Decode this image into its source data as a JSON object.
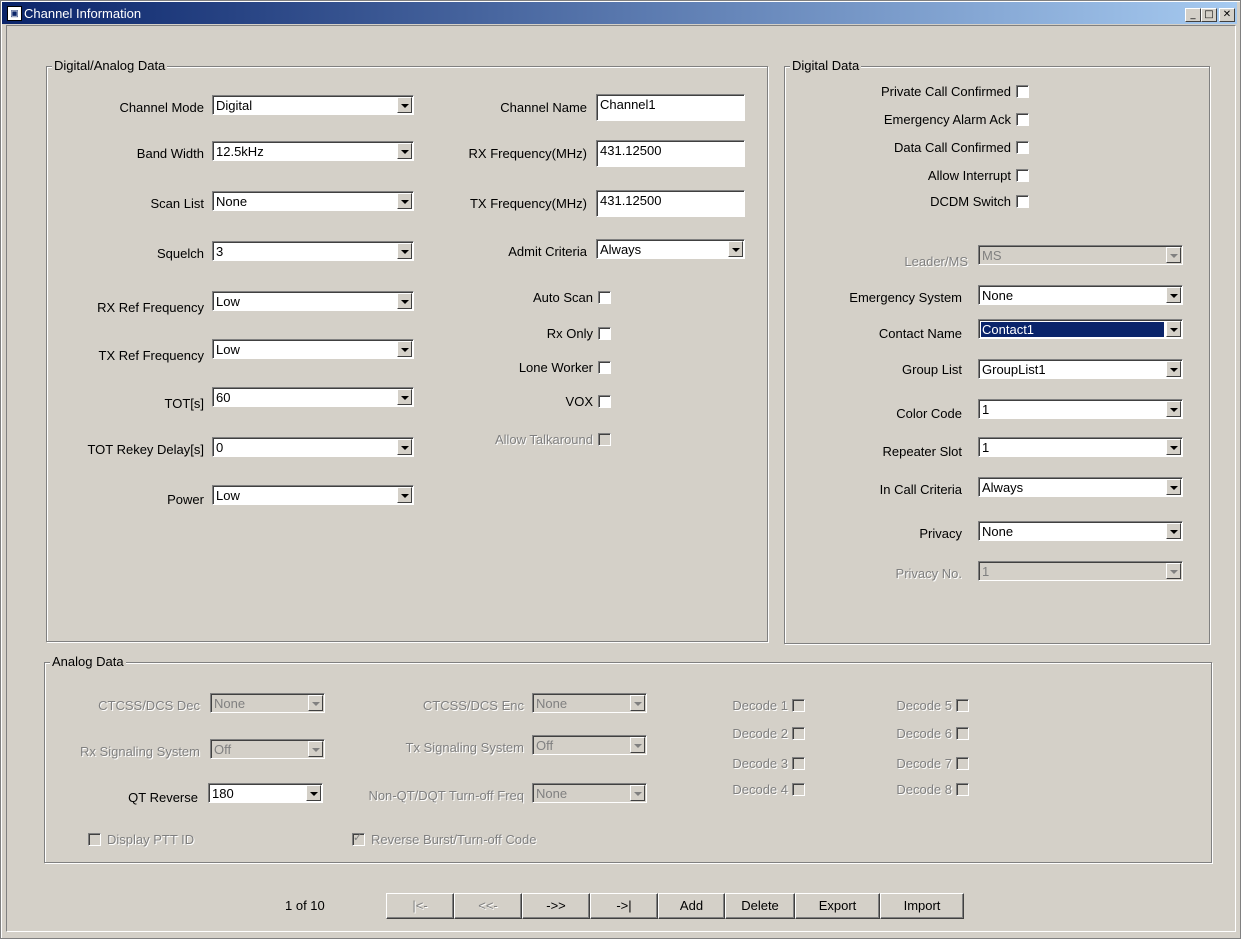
{
  "window": {
    "title": "Channel Information",
    "min_label": "_",
    "max_label": "□",
    "close_label": "✕"
  },
  "digital_analog": {
    "legend": "Digital/Analog Data",
    "channel_mode": {
      "label": "Channel Mode",
      "value": "Digital"
    },
    "band_width": {
      "label": "Band Width",
      "value": "12.5kHz"
    },
    "scan_list": {
      "label": "Scan List",
      "value": "None"
    },
    "squelch": {
      "label": "Squelch",
      "value": "3"
    },
    "rx_ref": {
      "label": "RX Ref Frequency",
      "value": "Low"
    },
    "tx_ref": {
      "label": "TX Ref Frequency",
      "value": "Low"
    },
    "tot": {
      "label": "TOT[s]",
      "value": "60"
    },
    "tot_rekey": {
      "label": "TOT Rekey Delay[s]",
      "value": "0"
    },
    "power": {
      "label": "Power",
      "value": "Low"
    },
    "channel_name": {
      "label": "Channel Name",
      "value": "Channel1"
    },
    "rx_freq": {
      "label": "RX Frequency(MHz)",
      "value": "431.12500"
    },
    "tx_freq": {
      "label": "TX Frequency(MHz)",
      "value": "431.12500"
    },
    "admit_criteria": {
      "label": "Admit Criteria",
      "value": "Always"
    },
    "auto_scan": {
      "label": "Auto Scan",
      "checked": false
    },
    "rx_only": {
      "label": "Rx Only",
      "checked": false
    },
    "lone_worker": {
      "label": "Lone Worker",
      "checked": false
    },
    "vox": {
      "label": "VOX",
      "checked": false
    },
    "allow_talkaround": {
      "label": "Allow Talkaround",
      "checked": false,
      "disabled": true
    }
  },
  "digital": {
    "legend": "Digital Data",
    "private_call": {
      "label": "Private Call Confirmed",
      "checked": false
    },
    "emergency_ack": {
      "label": "Emergency Alarm Ack",
      "checked": false
    },
    "data_call": {
      "label": "Data Call Confirmed",
      "checked": false
    },
    "allow_interrupt": {
      "label": "Allow Interrupt",
      "checked": false
    },
    "dcdm_switch": {
      "label": "DCDM Switch",
      "checked": false
    },
    "leader_ms": {
      "label": "Leader/MS",
      "value": "MS",
      "disabled": true
    },
    "emergency_system": {
      "label": "Emergency System",
      "value": "None"
    },
    "contact_name": {
      "label": "Contact Name",
      "value": "Contact1"
    },
    "group_list": {
      "label": "Group List",
      "value": "GroupList1"
    },
    "color_code": {
      "label": "Color Code",
      "value": "1"
    },
    "repeater_slot": {
      "label": "Repeater Slot",
      "value": "1"
    },
    "in_call_criteria": {
      "label": "In Call Criteria",
      "value": "Always"
    },
    "privacy": {
      "label": "Privacy",
      "value": "None"
    },
    "privacy_no": {
      "label": "Privacy No.",
      "value": "1",
      "disabled": true
    }
  },
  "analog": {
    "legend": "Analog Data",
    "ctcss_dec": {
      "label": "CTCSS/DCS Dec",
      "value": "None"
    },
    "rx_signaling": {
      "label": "Rx Signaling System",
      "value": "Off"
    },
    "qt_reverse": {
      "label": "QT Reverse",
      "value": "180"
    },
    "display_ptt": {
      "label": "Display PTT ID",
      "checked": false
    },
    "ctcss_enc": {
      "label": "CTCSS/DCS Enc",
      "value": "None"
    },
    "tx_signaling": {
      "label": "Tx Signaling System",
      "value": "Off"
    },
    "non_qt": {
      "label": "Non-QT/DQT Turn-off Freq",
      "value": "None"
    },
    "reverse_burst": {
      "label": "Reverse Burst/Turn-off Code",
      "checked": true
    },
    "decode": [
      "Decode 1",
      "Decode 2",
      "Decode 3",
      "Decode 4",
      "Decode 5",
      "Decode 6",
      "Decode 7",
      "Decode 8"
    ]
  },
  "nav": {
    "page_indicator": "1 of 10",
    "first": "|<-",
    "prev": "<<-",
    "next": "->>",
    "last": "->|",
    "add": "Add",
    "delete": "Delete",
    "export": "Export",
    "import": "Import"
  }
}
